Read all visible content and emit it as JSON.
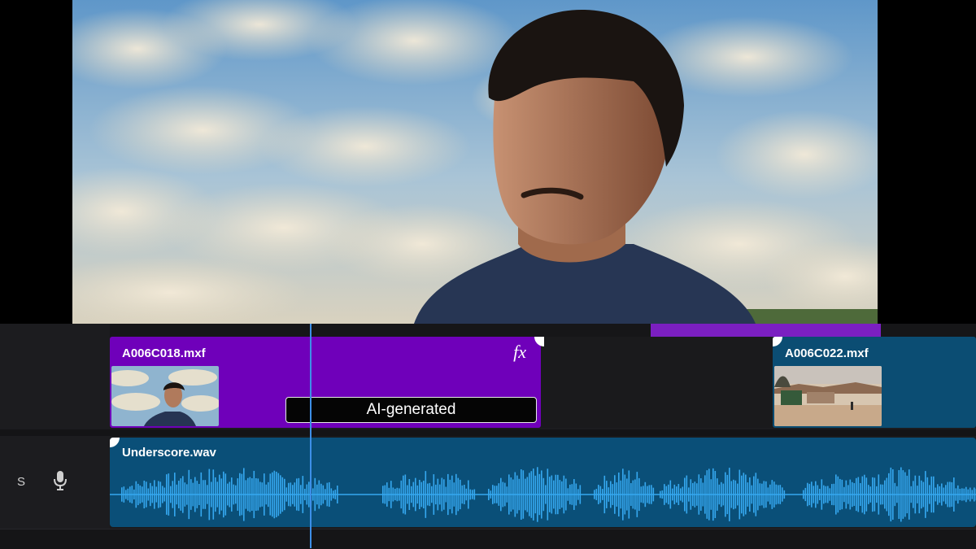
{
  "timeline": {
    "video_track": {
      "clips": [
        {
          "name": "A006C018.mxf",
          "badge": "AI-generated",
          "effect_icon": "fx-icon",
          "color": "#6f00ba"
        },
        {
          "name": "A006C022.mxf",
          "color": "#0b4d73"
        }
      ]
    },
    "audio_track": {
      "solo_label": "S",
      "mic_icon": "microphone-icon",
      "clip": {
        "name": "Underscore.wav",
        "color": "#0a4f78",
        "waveform_color": "#35a8f0"
      }
    },
    "playhead_color": "#3d8fe8",
    "work_area_color": "#7b1fc1"
  }
}
